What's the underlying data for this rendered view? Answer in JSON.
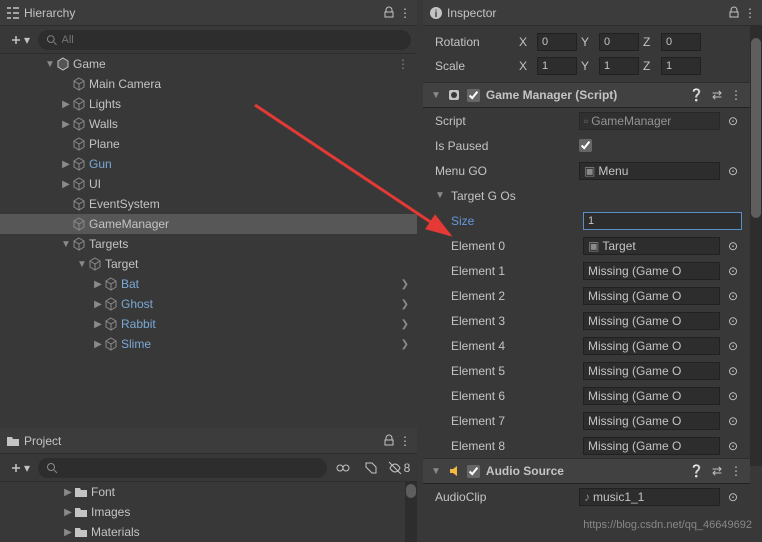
{
  "hierarchy": {
    "title": "Hierarchy",
    "search_placeholder": "All",
    "items": [
      {
        "label": "Game",
        "depth": 0,
        "expanded": true,
        "icon": "scene",
        "overflow": true
      },
      {
        "label": "Main Camera",
        "depth": 1,
        "icon": "cube"
      },
      {
        "label": "Lights",
        "depth": 1,
        "icon": "cube",
        "collapsed": true
      },
      {
        "label": "Walls",
        "depth": 1,
        "icon": "cube",
        "collapsed": true
      },
      {
        "label": "Plane",
        "depth": 1,
        "icon": "cube"
      },
      {
        "label": "Gun",
        "depth": 1,
        "icon": "cube",
        "prefab": true,
        "collapsed": true
      },
      {
        "label": "UI",
        "depth": 1,
        "icon": "cube",
        "collapsed": true
      },
      {
        "label": "EventSystem",
        "depth": 1,
        "icon": "cube"
      },
      {
        "label": "GameManager",
        "depth": 1,
        "icon": "cube",
        "selected": true
      },
      {
        "label": "Targets",
        "depth": 1,
        "icon": "cube",
        "expanded": true
      },
      {
        "label": "Target",
        "depth": 2,
        "icon": "cube",
        "expanded": true
      },
      {
        "label": "Bat",
        "depth": 3,
        "icon": "cube",
        "prefab": true,
        "collapsed": true,
        "chevron": true
      },
      {
        "label": "Ghost",
        "depth": 3,
        "icon": "cube",
        "prefab": true,
        "collapsed": true,
        "chevron": true
      },
      {
        "label": "Rabbit",
        "depth": 3,
        "icon": "cube",
        "prefab": true,
        "collapsed": true,
        "chevron": true
      },
      {
        "label": "Slime",
        "depth": 3,
        "icon": "cube",
        "prefab": true,
        "collapsed": true,
        "chevron": true
      }
    ]
  },
  "project": {
    "title": "Project",
    "hidden_count": "8",
    "items": [
      {
        "label": "Font",
        "depth": 2,
        "collapsed": true
      },
      {
        "label": "Images",
        "depth": 2,
        "collapsed": true
      },
      {
        "label": "Materials",
        "depth": 2,
        "collapsed": true
      }
    ]
  },
  "inspector": {
    "title": "Inspector",
    "transform": {
      "rotation_label": "Rotation",
      "scale_label": "Scale",
      "x_label": "X",
      "y_label": "Y",
      "z_label": "Z",
      "rotation": {
        "x": "0",
        "y": "0",
        "z": "0"
      },
      "scale": {
        "x": "1",
        "y": "1",
        "z": "1"
      }
    },
    "game_manager": {
      "title": "Game Manager (Script)",
      "script_label": "Script",
      "script_value": "GameManager",
      "is_paused_label": "Is Paused",
      "is_paused_value": true,
      "menu_go_label": "Menu GO",
      "menu_go_value": "Menu",
      "target_gos_label": "Target G Os",
      "size_label": "Size",
      "size_value": "1",
      "elements": [
        {
          "label": "Element 0",
          "value": "Target",
          "icon": true
        },
        {
          "label": "Element 1",
          "value": "Missing (Game O"
        },
        {
          "label": "Element 2",
          "value": "Missing (Game O"
        },
        {
          "label": "Element 3",
          "value": "Missing (Game O"
        },
        {
          "label": "Element 4",
          "value": "Missing (Game O"
        },
        {
          "label": "Element 5",
          "value": "Missing (Game O"
        },
        {
          "label": "Element 6",
          "value": "Missing (Game O"
        },
        {
          "label": "Element 7",
          "value": "Missing (Game O"
        },
        {
          "label": "Element 8",
          "value": "Missing (Game O"
        }
      ]
    },
    "audio_source": {
      "title": "Audio Source",
      "audio_clip_label": "AudioClip",
      "audio_clip_value": "music1_1"
    }
  },
  "watermark": "https://blog.csdn.net/qq_46649692"
}
